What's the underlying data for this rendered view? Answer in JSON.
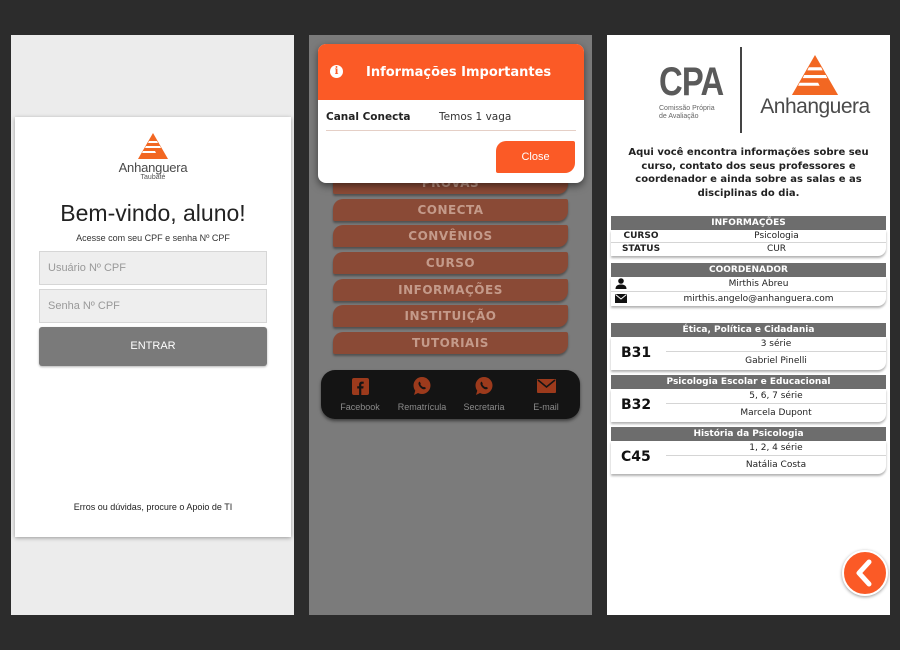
{
  "login": {
    "brand": "Anhanguera",
    "campus": "Taubaté",
    "welcome": "Bem-vindo, aluno!",
    "subtitle": "Acesse com seu CPF e senha Nº CPF",
    "user_placeholder": "Usuário Nº CPF",
    "password_placeholder": "Senha Nº CPF",
    "submit_label": "ENTRAR",
    "help_text": "Erros ou dúvidas, procure o Apoio de TI"
  },
  "menu": {
    "items": [
      "PROVAS",
      "CONECTA",
      "CONVÊNIOS",
      "CURSO",
      "INFORMAÇÕES",
      "INSTITUIÇÃO",
      "TUTORIAIS"
    ],
    "dock": [
      {
        "label": "Facebook",
        "icon": "facebook-icon"
      },
      {
        "label": "Rematrícula",
        "icon": "whatsapp-icon"
      },
      {
        "label": "Secretaria",
        "icon": "whatsapp-icon"
      },
      {
        "label": "E-mail",
        "icon": "mail-icon"
      }
    ],
    "modal": {
      "title": "Informações Importantes",
      "row_key": "Canal Conecta",
      "row_value": "Temos 1 vaga",
      "close_label": "Close"
    },
    "accent": "#fb5a26"
  },
  "course": {
    "cpa_title": "CPA",
    "cpa_subtitle_1": "Comissão Própria",
    "cpa_subtitle_2": "de Avaliação",
    "brand": "Anhanguera",
    "intro": "Aqui você encontra informações sobre seu curso, contato dos seus professores e coordenador e ainda sobre as salas e as disciplinas do dia.",
    "info": {
      "header": "INFORMAÇÕES",
      "curso_label": "CURSO",
      "curso_value": "Psicologia",
      "status_label": "STATUS",
      "status_value": "CUR"
    },
    "coordinator": {
      "header": "COORDENADOR",
      "name": "Mirthis Abreu",
      "email": "mirthis.angelo@anhanguera.com"
    },
    "disciplines": [
      {
        "name": "Ética, Política e Cidadania",
        "room": "B31",
        "series": "3 série",
        "teacher": "Gabriel Pinelli"
      },
      {
        "name": "Psicologia Escolar e Educacional",
        "room": "B32",
        "series": "5, 6, 7 série",
        "teacher": "Marcela Dupont"
      },
      {
        "name": "História da Psicologia",
        "room": "C45",
        "series": "1, 2, 4 série",
        "teacher": "Natália Costa"
      }
    ]
  }
}
